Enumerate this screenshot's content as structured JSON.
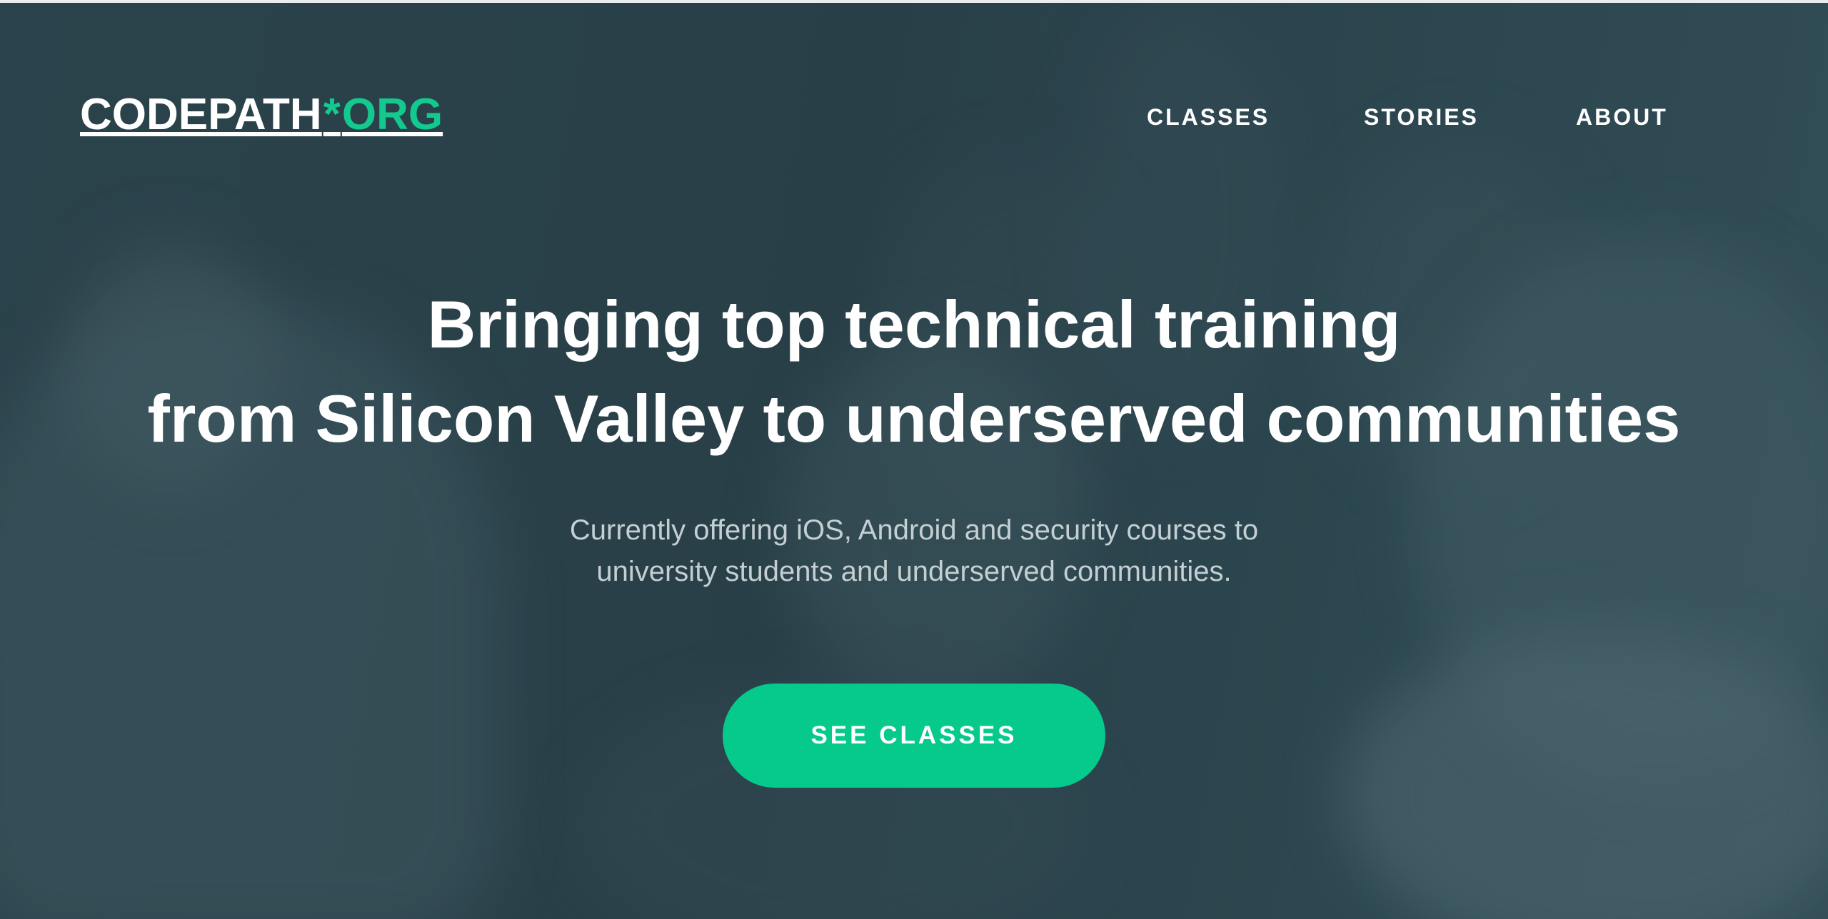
{
  "nav": {
    "logo": {
      "primary": "CODEPATH",
      "separator": "*",
      "suffix": "ORG"
    },
    "links": [
      {
        "label": "CLASSES"
      },
      {
        "label": "STORIES"
      },
      {
        "label": "ABOUT"
      }
    ]
  },
  "hero": {
    "headline_line1": "Bringing top technical training",
    "headline_line2": "from Silicon Valley to underserved communities",
    "subtext_line1": "Currently offering iOS, Android and security courses to",
    "subtext_line2": "university students and underserved communities.",
    "cta_label": "SEE CLASSES"
  },
  "colors": {
    "accent": "#06c98c",
    "background": "#2d444c",
    "text": "#ffffff",
    "subtext": "#c3cfd2"
  }
}
